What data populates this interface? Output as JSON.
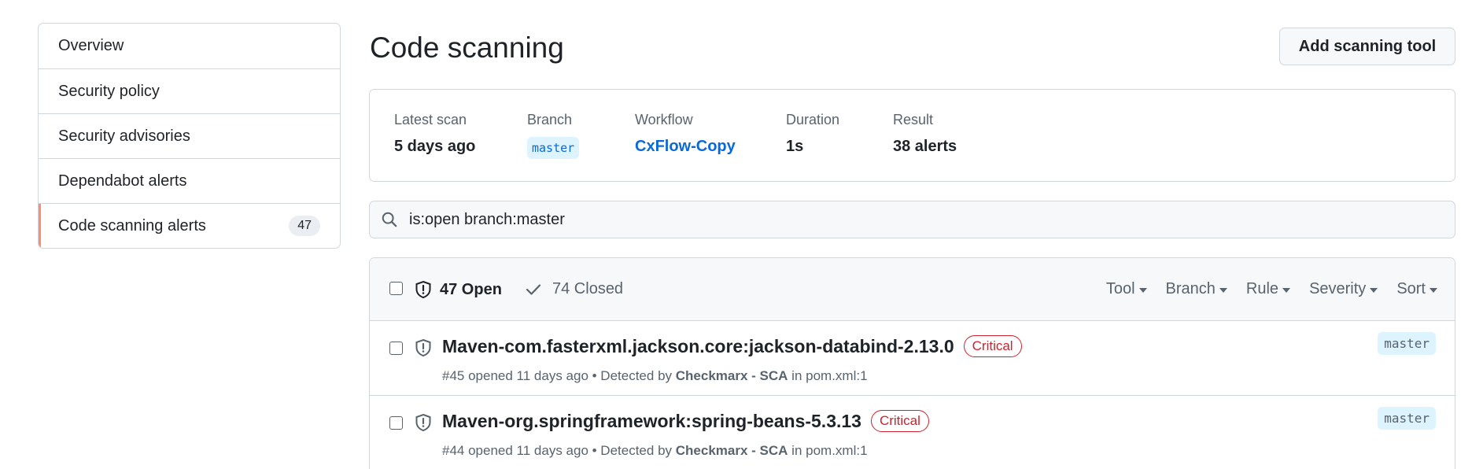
{
  "sidebar": {
    "items": [
      {
        "label": "Overview"
      },
      {
        "label": "Security policy"
      },
      {
        "label": "Security advisories"
      },
      {
        "label": "Dependabot alerts"
      },
      {
        "label": "Code scanning alerts",
        "count": "47",
        "active": true
      }
    ]
  },
  "header": {
    "title": "Code scanning",
    "add_button": "Add scanning tool"
  },
  "scan": {
    "latest_label": "Latest scan",
    "latest_value": "5 days ago",
    "branch_label": "Branch",
    "branch_value": "master",
    "workflow_label": "Workflow",
    "workflow_value": "CxFlow-Copy",
    "duration_label": "Duration",
    "duration_value": "1s",
    "result_label": "Result",
    "result_value": "38 alerts"
  },
  "search": {
    "value": "is:open branch:master"
  },
  "alerts_header": {
    "open": "47 Open",
    "closed": "74 Closed",
    "filters": [
      "Tool",
      "Branch",
      "Rule",
      "Severity",
      "Sort"
    ]
  },
  "alerts": [
    {
      "title": "Maven-com.fasterxml.jackson.core:jackson-databind-2.13.0",
      "severity": "Critical",
      "meta_prefix": "#45 opened 11 days ago • Detected by",
      "tool": "Checkmarx - SCA",
      "meta_suffix": "in pom.xml:1",
      "branch": "master"
    },
    {
      "title": "Maven-org.springframework:spring-beans-5.3.13",
      "severity": "Critical",
      "meta_prefix": "#44 opened 11 days ago • Detected by",
      "tool": "Checkmarx - SCA",
      "meta_suffix": "in pom.xml:1",
      "branch": "master"
    }
  ],
  "colors": {
    "accent": "#fd8c73",
    "link": "#0969da",
    "critical": "#cf222e"
  },
  "icons": [
    "search-icon",
    "shield-icon",
    "check-icon",
    "caret-down-icon"
  ]
}
